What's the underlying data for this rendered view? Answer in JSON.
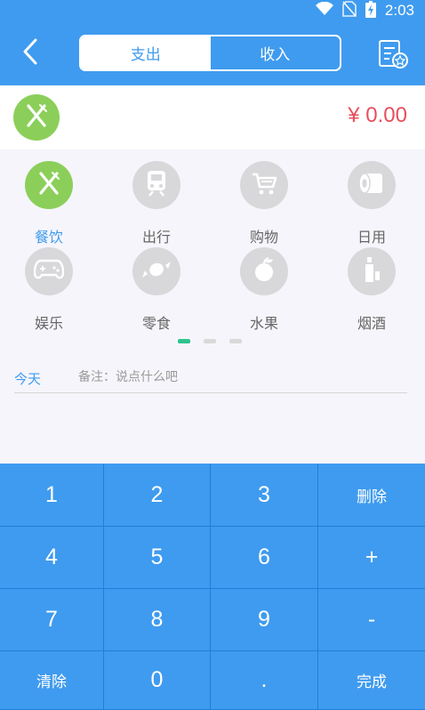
{
  "status_bar": {
    "time": "2:03",
    "icons": [
      "wifi-icon",
      "no-sim-icon",
      "battery-charging-icon"
    ]
  },
  "header": {
    "back_icon": "chevron-left-icon",
    "tabs": [
      {
        "label": "支出",
        "active": true
      },
      {
        "label": "收入",
        "active": false
      }
    ],
    "bill_icon": "bill-settings-icon"
  },
  "amount": {
    "selected_category_icon": "fork-knife-icon",
    "value": "¥ 0.00"
  },
  "categories": [
    {
      "label": "餐饮",
      "icon": "fork-knife-icon",
      "active": true
    },
    {
      "label": "出行",
      "icon": "train-icon",
      "active": false
    },
    {
      "label": "购物",
      "icon": "shopping-cart-icon",
      "active": false
    },
    {
      "label": "日用",
      "icon": "tissue-roll-icon",
      "active": false
    },
    {
      "label": "娱乐",
      "icon": "gamepad-icon",
      "active": false
    },
    {
      "label": "零食",
      "icon": "candy-icon",
      "active": false
    },
    {
      "label": "水果",
      "icon": "fruit-icon",
      "active": false
    },
    {
      "label": "烟酒",
      "icon": "bottle-icon",
      "active": false
    }
  ],
  "pager": {
    "pages": 3,
    "current": 1
  },
  "note": {
    "date_label": "今天",
    "placeholder": "备注：说点什么吧",
    "value": ""
  },
  "keypad": {
    "keys": [
      "1",
      "2",
      "3",
      "删除",
      "4",
      "5",
      "6",
      "+",
      "7",
      "8",
      "9",
      "-",
      "清除",
      "0",
      ".",
      "完成"
    ]
  },
  "colors": {
    "primary": "#3f9bef",
    "active_category": "#8bcf5a",
    "inactive_category": "#d8d8da",
    "amount": "#e94e5d",
    "pager_active": "#2ec38d"
  }
}
